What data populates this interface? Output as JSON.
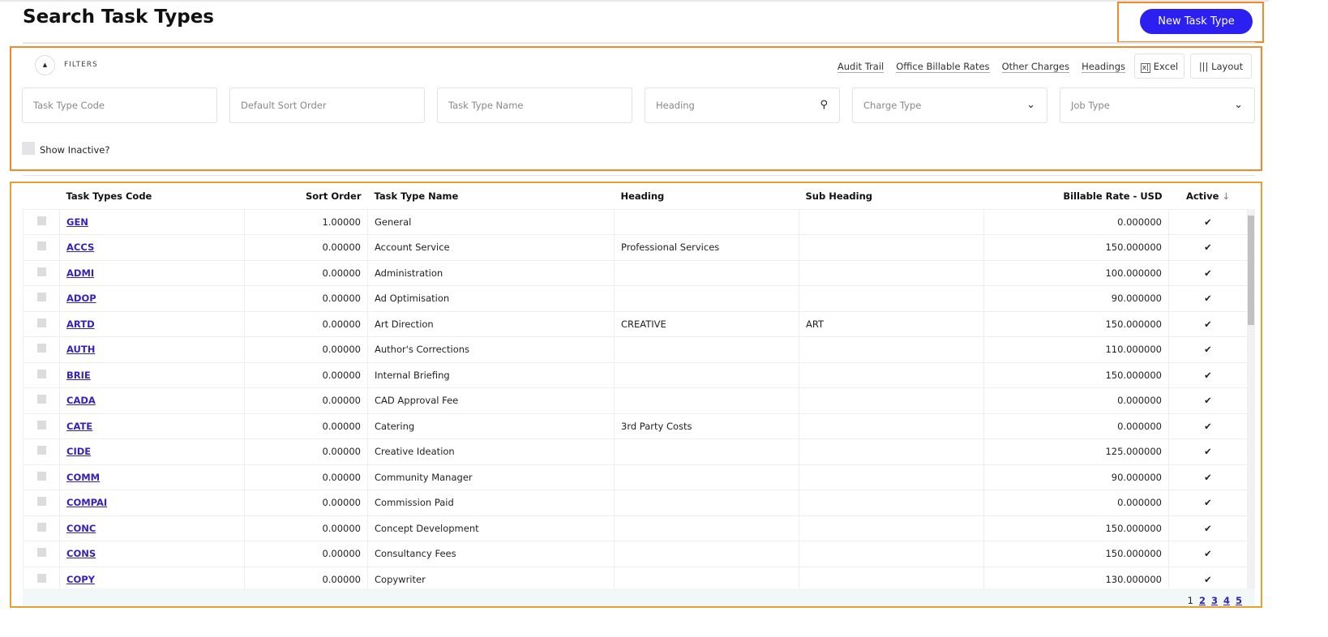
{
  "title": "Search Task Types",
  "new_button": "New Task Type",
  "filters": {
    "label": "FILTERS",
    "links": [
      "Audit Trail",
      "Office Billable Rates",
      "Other Charges",
      "Headings"
    ],
    "excel": "Excel",
    "layout": "Layout",
    "fields": [
      {
        "placeholder": "Task Type Code"
      },
      {
        "placeholder": "Default Sort Order"
      },
      {
        "placeholder": "Task Type Name"
      },
      {
        "placeholder": "Heading"
      },
      {
        "placeholder": "Charge Type"
      },
      {
        "placeholder": "Job Type"
      }
    ],
    "show_inactive": "Show Inactive?"
  },
  "table": {
    "headers": [
      "Task Types Code",
      "Sort Order",
      "Task Type Name",
      "Heading",
      "Sub Heading",
      "Billable Rate - USD",
      "Active"
    ],
    "rows": [
      [
        "GEN",
        "1.00000",
        "General",
        "",
        "",
        "0.000000"
      ],
      [
        "ACCS",
        "0.00000",
        "Account Service",
        "Professional Services",
        "",
        "150.000000"
      ],
      [
        "ADMI",
        "0.00000",
        "Administration",
        "",
        "",
        "100.000000"
      ],
      [
        "ADOP",
        "0.00000",
        "Ad Optimisation",
        "",
        "",
        "90.000000"
      ],
      [
        "ARTD",
        "0.00000",
        "Art Direction",
        "CREATIVE",
        "ART",
        "150.000000"
      ],
      [
        "AUTH",
        "0.00000",
        "Author's Corrections",
        "",
        "",
        "110.000000"
      ],
      [
        "BRIE",
        "0.00000",
        "Internal Briefing",
        "",
        "",
        "150.000000"
      ],
      [
        "CADA",
        "0.00000",
        "CAD Approval Fee",
        "",
        "",
        "0.000000"
      ],
      [
        "CATE",
        "0.00000",
        "Catering",
        "3rd Party Costs",
        "",
        "0.000000"
      ],
      [
        "CIDE",
        "0.00000",
        "Creative Ideation",
        "",
        "",
        "125.000000"
      ],
      [
        "COMM",
        "0.00000",
        "Community Manager",
        "",
        "",
        "90.000000"
      ],
      [
        "COMPAI",
        "0.00000",
        "Commission Paid",
        "",
        "",
        "0.000000"
      ],
      [
        "CONC",
        "0.00000",
        "Concept Development",
        "",
        "",
        "150.000000"
      ],
      [
        "CONS",
        "0.00000",
        "Consultancy Fees",
        "",
        "",
        "150.000000"
      ],
      [
        "COPY",
        "0.00000",
        "Copywriter",
        "",
        "",
        "130.000000"
      ]
    ]
  },
  "pagination": {
    "current": "1",
    "pages": [
      "2",
      "3",
      "4",
      "5"
    ]
  }
}
